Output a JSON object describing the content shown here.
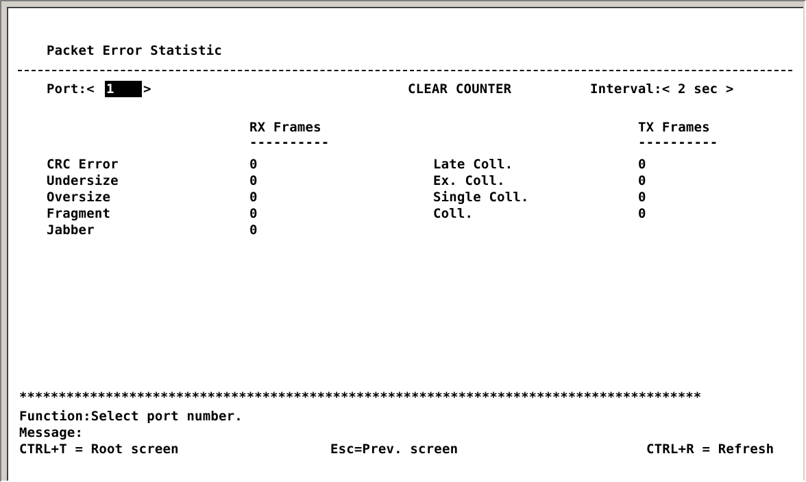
{
  "title": "Packet Error Statistic",
  "port": {
    "label_prefix": "Port:<",
    "value": "1",
    "label_suffix": ">"
  },
  "clear_counter": "CLEAR COUNTER",
  "interval": "Interval:< 2 sec >",
  "rx_header": "RX Frames",
  "rx_underline": "----------",
  "tx_header": "TX Frames",
  "tx_underline": "----------",
  "rx_rows": [
    {
      "label": "CRC Error",
      "value": "0"
    },
    {
      "label": "Undersize",
      "value": "0"
    },
    {
      "label": "Oversize",
      "value": "0"
    },
    {
      "label": "Fragment",
      "value": "0"
    },
    {
      "label": "Jabber",
      "value": "0"
    }
  ],
  "tx_rows": [
    {
      "label": "Late Coll.",
      "value": "0"
    },
    {
      "label": "Ex. Coll.",
      "value": "0"
    },
    {
      "label": "Single Coll.",
      "value": "0"
    },
    {
      "label": "Coll.",
      "value": "0"
    }
  ],
  "stars": "***************************************************************************************",
  "function_line": "Function:Select port number.",
  "message_line": "Message:",
  "footer": {
    "root": "CTRL+T = Root screen",
    "prev": "Esc=Prev. screen",
    "refresh": "CTRL+R = Refresh"
  }
}
